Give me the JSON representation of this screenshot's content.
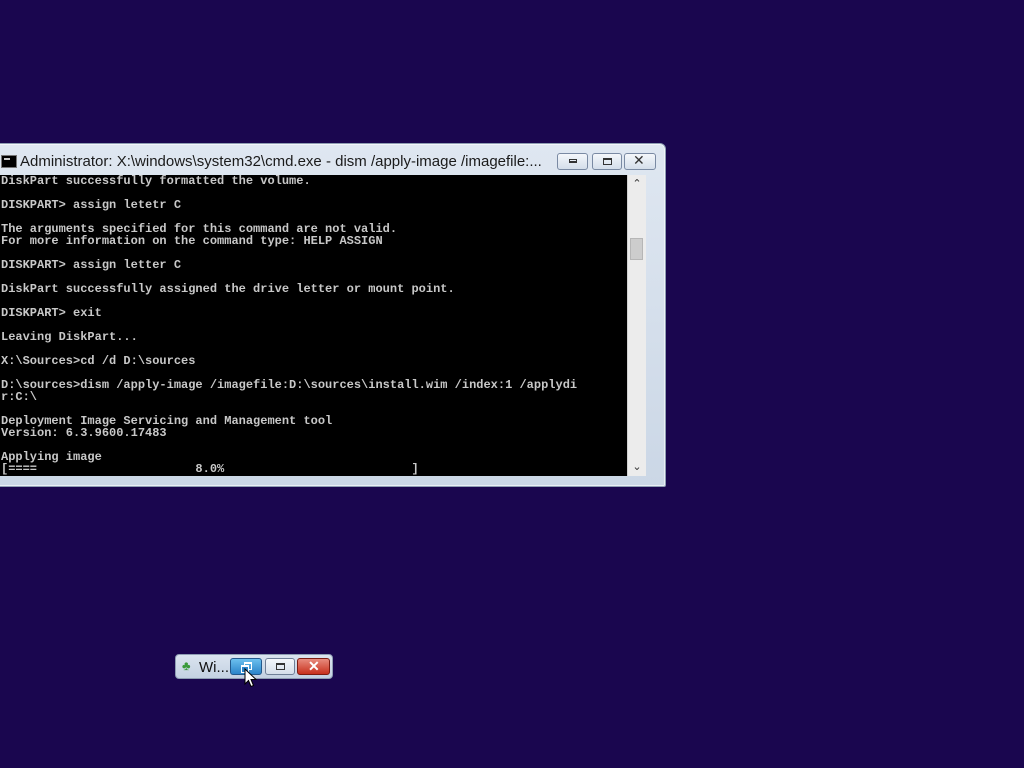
{
  "desktop": {
    "background_color": "#1a064f"
  },
  "cmd_window": {
    "title": "Administrator: X:\\windows\\system32\\cmd.exe - dism  /apply-image /imagefile:...",
    "icon": "console-icon",
    "buttons": {
      "minimize_icon": "minimize-icon",
      "maximize_icon": "maximize-icon",
      "close_icon": "close-icon",
      "close_glyph": "✕"
    },
    "console_lines": [
      "DiskPart successfully formatted the volume.",
      "",
      "DISKPART> assign letetr C",
      "",
      "The arguments specified for this command are not valid.",
      "For more information on the command type: HELP ASSIGN",
      "",
      "DISKPART> assign letter C",
      "",
      "DiskPart successfully assigned the drive letter or mount point.",
      "",
      "DISKPART> exit",
      "",
      "Leaving DiskPart...",
      "",
      "X:\\Sources>cd /d D:\\sources",
      "",
      "D:\\sources>dism /apply-image /imagefile:D:\\sources\\install.wim /index:1 /applydi",
      "r:C:\\",
      "",
      "Deployment Image Servicing and Management tool",
      "Version: 6.3.9600.17483",
      "",
      "Applying image",
      "[====                      8.0%                          ]"
    ],
    "progress_percent": 8.0,
    "scrollbar": {
      "up_glyph": "⌃",
      "down_glyph": "⌄"
    }
  },
  "minimized_window": {
    "title": "Wi...",
    "icon": "windows-setup-icon",
    "icon_glyph": "♣",
    "buttons": {
      "restore_icon": "restore-icon",
      "maximize_icon": "maximize-icon",
      "close_icon": "close-icon",
      "close_glyph": "✕"
    },
    "colors": {
      "restore": "#2b84c9",
      "close": "#c7301d"
    }
  }
}
